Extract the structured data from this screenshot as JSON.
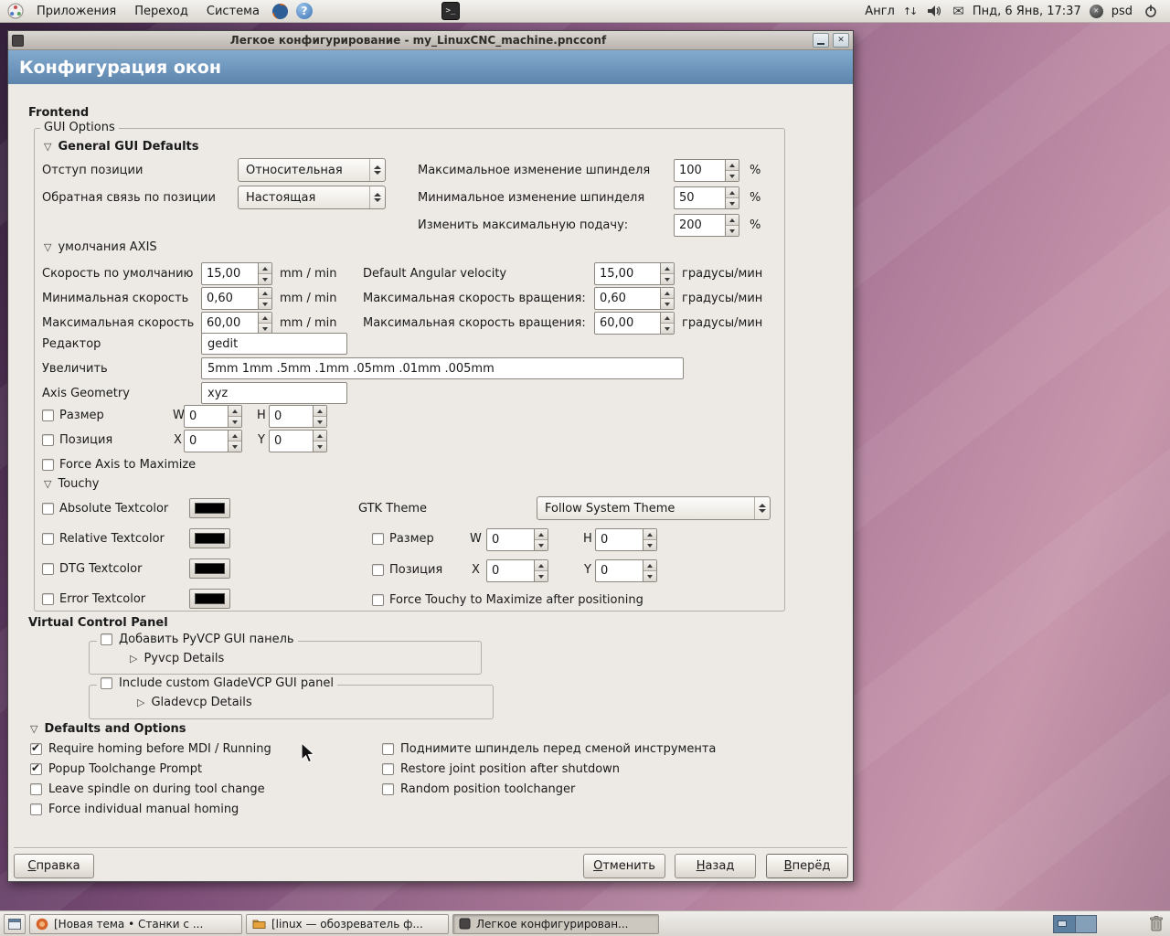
{
  "icons": {
    "expander_open": "▽",
    "expander_closed": "▷",
    "terminal_prompt": ">_",
    "help_mark": "?",
    "keyboard_arrows": "↑↓",
    "mail": "✉",
    "close": "✕"
  },
  "panel": {
    "menus": [
      {
        "label": "Приложения"
      },
      {
        "label": "Переход"
      },
      {
        "label": "Система"
      }
    ],
    "keyboard_layout": "Англ",
    "clock": "Пнд, 6 Янв, 17:37",
    "user": "psd"
  },
  "window": {
    "title": "Легкое конфигурирование - my_LinuxCNC_machine.pncconf",
    "page_title": "Конфигурация окон"
  },
  "frontend": {
    "section_label": "Frontend",
    "frame_label": "GUI Options",
    "general": {
      "title": "General GUI Defaults",
      "position_offset": {
        "label": "Отступ позиции",
        "value": "Относительная"
      },
      "position_feedback": {
        "label": "Обратная связь по позиции",
        "value": "Настоящая"
      },
      "spindle_max": {
        "label": "Максимальное изменение шпинделя",
        "value": "100",
        "unit": "%"
      },
      "spindle_min": {
        "label": "Минимальное изменение шпинделя",
        "value": "50",
        "unit": "%"
      },
      "feed_max": {
        "label": "Изменить максимальную подачу:",
        "value": "200",
        "unit": "%"
      }
    },
    "axis": {
      "title": "умолчания AXIS",
      "rows_left": [
        {
          "label": "Скорость по умолчанию",
          "value": "15,00",
          "unit": "mm / min"
        },
        {
          "label": "Минимальная скорость",
          "value": "0,60",
          "unit": "mm / min"
        },
        {
          "label": "Максимальная скорость",
          "value": "60,00",
          "unit": "mm / min"
        }
      ],
      "rows_right": [
        {
          "label": "Default Angular velocity",
          "value": "15,00",
          "unit": "градусы/мин"
        },
        {
          "label": "Максимальная скорость вращения:",
          "value": "0,60",
          "unit": "градусы/мин"
        },
        {
          "label": "Максимальная скорость вращения:",
          "value": "60,00",
          "unit": "градусы/мин"
        }
      ],
      "editor": {
        "label": "Редактор",
        "value": "gedit"
      },
      "increments": {
        "label": "Увеличить",
        "value": "5mm 1mm .5mm .1mm .05mm .01mm .005mm"
      },
      "geometry": {
        "label": "Axis Geometry",
        "value": "xyz"
      },
      "size": {
        "label": "Размер",
        "checked": false,
        "w_label": "W",
        "w": "0",
        "h_label": "H",
        "h": "0"
      },
      "position": {
        "label": "Позиция",
        "checked": false,
        "x_label": "X",
        "x": "0",
        "y_label": "Y",
        "y": "0"
      },
      "force_max": {
        "label": "Force Axis to Maximize",
        "checked": false
      }
    },
    "touchy": {
      "title": "Touchy",
      "colors": [
        {
          "label": "Absolute Textcolor",
          "checked": false,
          "color": "#000000"
        },
        {
          "label": "Relative Textcolor",
          "checked": false,
          "color": "#000000"
        },
        {
          "label": "DTG Textcolor",
          "checked": false,
          "color": "#000000"
        },
        {
          "label": "Error Textcolor",
          "checked": false,
          "color": "#000000"
        }
      ],
      "gtk_theme": {
        "label": "GTK Theme",
        "value": "Follow System Theme"
      },
      "size": {
        "label": "Размер",
        "checked": false,
        "w_label": "W",
        "w": "0",
        "h_label": "H",
        "h": "0"
      },
      "position": {
        "label": "Позиция",
        "checked": false,
        "x_label": "X",
        "x": "0",
        "y_label": "Y",
        "y": "0"
      },
      "force_max": {
        "label": "Force Touchy to Maximize after positioning",
        "checked": false
      }
    }
  },
  "vcp": {
    "section_label": "Virtual Control Panel",
    "pyvcp": {
      "label": "Добавить PyVCP GUI панель",
      "checked": false,
      "details": "Pyvcp Details"
    },
    "gladevcp": {
      "label": "Include custom GladeVCP GUI panel",
      "checked": false,
      "details": "Gladevcp Details"
    }
  },
  "defaults": {
    "title": "Defaults and Options",
    "left": [
      {
        "label": "Require homing before MDI / Running",
        "checked": true
      },
      {
        "label": "Popup Toolchange Prompt",
        "checked": true
      },
      {
        "label": "Leave spindle on during tool change",
        "checked": false
      },
      {
        "label": "Force individual manual homing",
        "checked": false
      }
    ],
    "right": [
      {
        "label": "Поднимите шпиндель перед сменой инструмента",
        "checked": false
      },
      {
        "label": "Restore joint position after shutdown",
        "checked": false
      },
      {
        "label": "Random position toolchanger",
        "checked": false
      }
    ]
  },
  "buttons": {
    "help": "Справка",
    "cancel": "Отменить",
    "back": "Назад",
    "forward": "Вперёд"
  },
  "taskbar": {
    "items": [
      {
        "label": "[Новая тема • Станки с ...",
        "active": false
      },
      {
        "label": "[linux — обозреватель ф...",
        "active": false
      },
      {
        "label": "Легкое конфигурирован...",
        "active": true
      }
    ]
  }
}
